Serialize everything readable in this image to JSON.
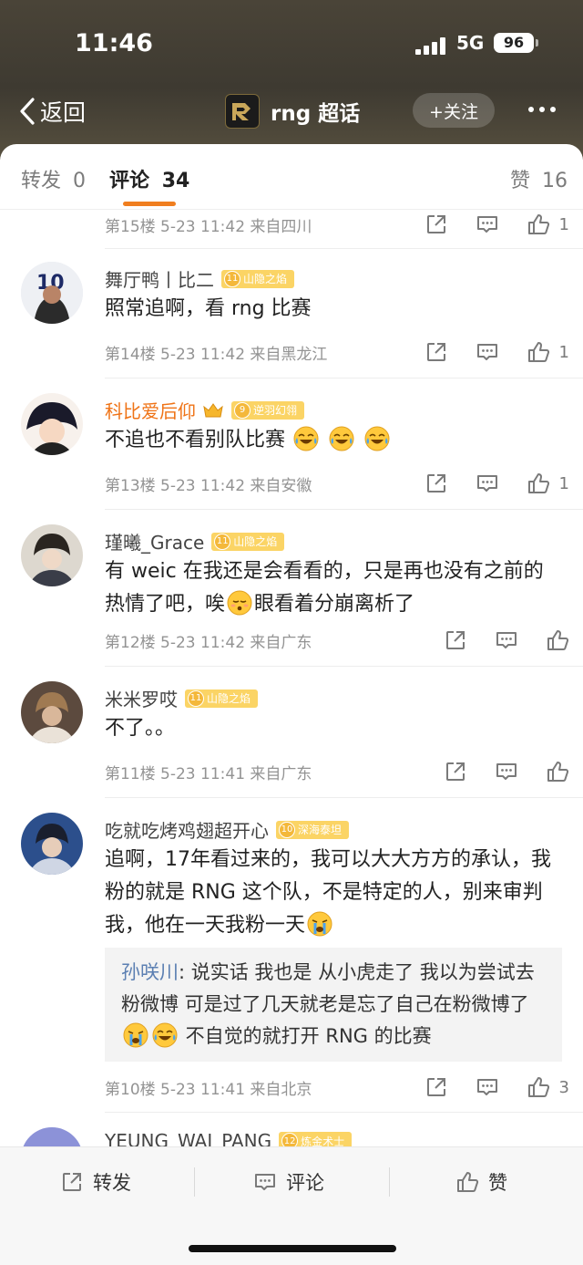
{
  "status": {
    "time": "11:46",
    "network": "5G",
    "battery": "96"
  },
  "nav": {
    "back_label": "返回",
    "title": "rng 超话",
    "follow_label": "+关注"
  },
  "tabs": {
    "repost_label": "转发",
    "repost_count": "0",
    "comment_label": "评论",
    "comment_count": "34",
    "like_label": "赞",
    "like_count": "16"
  },
  "comments": [
    {
      "floor_meta": "第15楼  5-23 11:42  来自四川",
      "likes": "1"
    },
    {
      "name": "舞厅鸭丨比二",
      "badge_level": "11",
      "badge_label": "山隐之焰",
      "text": "照常追啊，看 rng 比赛",
      "floor_meta": "第14楼  5-23 11:42  来自黑龙江",
      "likes": "1"
    },
    {
      "name": "科比爱后仰",
      "badge_level": "9",
      "badge_label": "逆羽幻翎",
      "text": "不追也不看别队比赛",
      "floor_meta": "第13楼  5-23 11:42  来自安徽",
      "likes": "1"
    },
    {
      "name": "瑾曦_Grace",
      "badge_level": "11",
      "badge_label": "山隐之焰",
      "text_a": "有 weic 在我还是会看看的，只是再也没有之前的热情了吧，唉",
      "text_b": "眼看着分崩离析了",
      "floor_meta": "第12楼  5-23 11:42  来自广东",
      "likes": ""
    },
    {
      "name": "米米罗哎",
      "badge_level": "11",
      "badge_label": "山隐之焰",
      "text": "不了。。",
      "floor_meta": "第11楼  5-23 11:41  来自广东",
      "likes": ""
    },
    {
      "name": "吃就吃烤鸡翅超开心",
      "badge_level": "10",
      "badge_label": "深海泰坦",
      "text": "追啊，17年看过来的，我可以大大方方的承认，我粉的就是 RNG 这个队，不是特定的人，别来审判我，他在一天我粉一天",
      "reply": {
        "name": "孙咲川",
        "text_a": ": 说实话 我也是 从小虎走了 我以为尝试去粉微博 可是过了几天就老是忘了自己在粉微博了",
        "text_b": " 不自觉的就打开 RNG 的比赛"
      },
      "floor_meta": "第10楼  5-23 11:41  来自北京",
      "likes": "3"
    },
    {
      "name": "YEUNG_WAI_PANG",
      "badge_level": "12",
      "badge_label": "炼金术士"
    }
  ],
  "bottom": {
    "repost": "转发",
    "comment": "评论",
    "like": "赞"
  },
  "icons": [
    "back-chevron-icon",
    "share-icon",
    "comment-icon",
    "thumb-up-icon",
    "crown-icon",
    "laugh-cry-emoji",
    "sigh-emoji",
    "sob-emoji"
  ],
  "colors": {
    "accent": "#f07e1f",
    "header_bg": "#433e33",
    "badge": "#fbd465",
    "link": "#5b7fb2"
  }
}
